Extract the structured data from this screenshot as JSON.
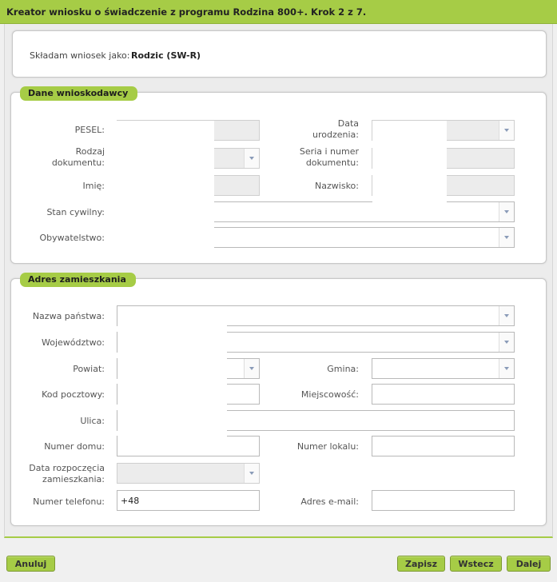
{
  "title": "Kreator wniosku o świadczenie z programu Rodzina 800+. Krok 2 z 7.",
  "applicant_role": {
    "label": "Składam wniosek jako:",
    "value": "Rodzic (SW-R)"
  },
  "sections": {
    "applicant": {
      "legend": "Dane wnioskodawcy",
      "pesel": "PESEL:",
      "birth_date_l1": "Data",
      "birth_date_l2": "urodzenia:",
      "doc_type_l1": "Rodzaj",
      "doc_type_l2": "dokumentu:",
      "doc_number_l1": "Seria i numer",
      "doc_number_l2": "dokumentu:",
      "first_name": "Imię:",
      "last_name": "Nazwisko:",
      "marital_status": "Stan cywilny:",
      "citizenship": "Obywatelstwo:"
    },
    "address": {
      "legend": "Adres zamieszkania",
      "country": "Nazwa państwa:",
      "voivodeship": "Województwo:",
      "county": "Powiat:",
      "commune": "Gmina:",
      "postal_code": "Kod pocztowy:",
      "city": "Miejscowość:",
      "street": "Ulica:",
      "house_number": "Numer domu:",
      "apartment_number": "Numer lokalu:",
      "residence_start_l1": "Data rozpoczęcia",
      "residence_start_l2": "zamieszkania:",
      "phone": "Numer telefonu:",
      "phone_value": "+48",
      "email": "Adres e-mail:"
    }
  },
  "buttons": {
    "cancel": "Anuluj",
    "save": "Zapisz",
    "back": "Wstecz",
    "next": "Dalej"
  }
}
